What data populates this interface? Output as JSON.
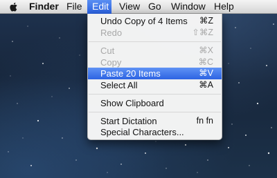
{
  "menubar": {
    "app_name": "Finder",
    "items": [
      "File",
      "Edit",
      "View",
      "Go",
      "Window",
      "Help"
    ],
    "active_item": "Edit"
  },
  "edit_menu": {
    "items": [
      {
        "label": "Undo Copy of 4 Items",
        "shortcut": "⌘Z",
        "enabled": true
      },
      {
        "label": "Redo",
        "shortcut": "⇧⌘Z",
        "enabled": false
      },
      {
        "label": "Cut",
        "shortcut": "⌘X",
        "enabled": false
      },
      {
        "label": "Copy",
        "shortcut": "⌘C",
        "enabled": false
      },
      {
        "label": "Paste 20 Items",
        "shortcut": "⌘V",
        "enabled": true,
        "highlighted": true
      },
      {
        "label": "Select All",
        "shortcut": "⌘A",
        "enabled": true
      },
      {
        "label": "Show Clipboard",
        "shortcut": "",
        "enabled": true
      },
      {
        "label": "Start Dictation",
        "shortcut": "fn fn",
        "enabled": true
      },
      {
        "label": "Special Characters...",
        "shortcut": "",
        "enabled": true
      }
    ]
  },
  "colors": {
    "highlight": "#2c63e2",
    "disabled_text": "#a8a8a8"
  }
}
